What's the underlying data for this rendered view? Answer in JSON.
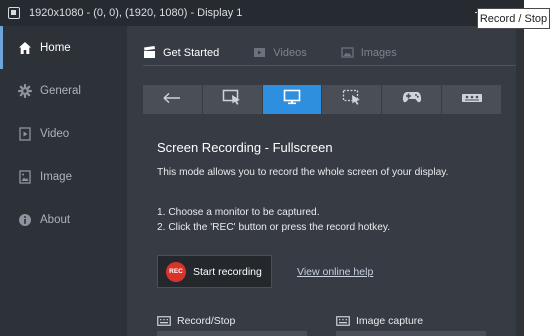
{
  "window": {
    "title": "1920x1080 - (0, 0), (1920, 1080) - Display 1"
  },
  "tooltip": {
    "text": "Record / Stop"
  },
  "sidebar": {
    "items": [
      {
        "label": "Home",
        "icon": "home-icon",
        "active": true
      },
      {
        "label": "General",
        "icon": "gear-icon",
        "active": false
      },
      {
        "label": "Video",
        "icon": "video-icon",
        "active": false
      },
      {
        "label": "Image",
        "icon": "image-icon",
        "active": false
      },
      {
        "label": "About",
        "icon": "info-icon",
        "active": false
      }
    ]
  },
  "tabs": [
    {
      "label": "Get Started",
      "icon": "clapperboard-icon",
      "active": true
    },
    {
      "label": "Videos",
      "icon": "video-file-icon",
      "active": false
    },
    {
      "label": "Images",
      "icon": "image-file-icon",
      "active": false
    }
  ],
  "modes": [
    {
      "icon": "arrow-left-icon",
      "active": false
    },
    {
      "icon": "rectangle-select-icon",
      "active": false
    },
    {
      "icon": "monitor-icon",
      "active": true
    },
    {
      "icon": "region-dashed-icon",
      "active": false
    },
    {
      "icon": "gamepad-icon",
      "active": false
    },
    {
      "icon": "device-capture-icon",
      "active": false
    }
  ],
  "content": {
    "heading": "Screen Recording - Fullscreen",
    "description": "This mode allows you to record the whole screen of your display.",
    "step1": "1. Choose a monitor to be captured.",
    "step2": "2. Click the 'REC' button or press the record hotkey.",
    "rec_badge": "REC",
    "rec_button": "Start recording",
    "help_link": "View online help"
  },
  "hotkeys": {
    "record_label": "Record/Stop",
    "image_label": "Image capture"
  },
  "colors": {
    "accent": "#2f8fdf",
    "rec_red": "#d9342b",
    "sidebar_bg": "#2d3138",
    "main_bg": "#373b43",
    "titlebar_bg": "#262a31"
  }
}
